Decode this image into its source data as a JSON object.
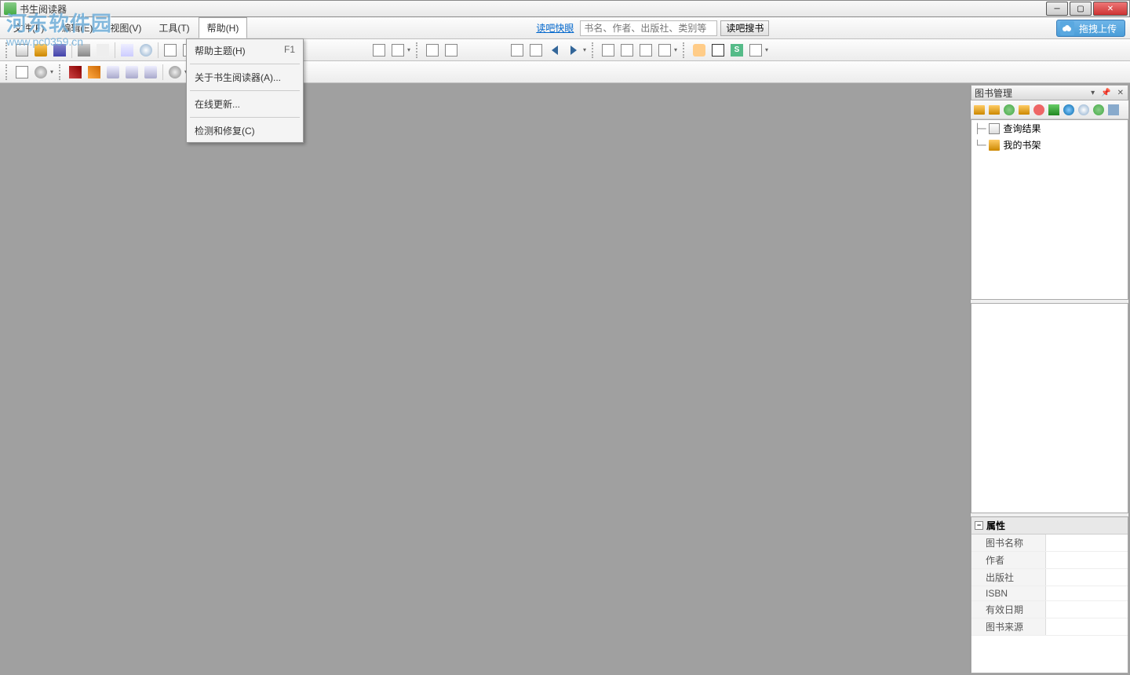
{
  "window": {
    "title": "书生阅读器"
  },
  "watermark": {
    "line1": "河东软件园",
    "line2": "www.pc0359.cn"
  },
  "menubar": {
    "items": [
      {
        "label": "文件(F)"
      },
      {
        "label": "编辑(E)"
      },
      {
        "label": "视图(V)"
      },
      {
        "label": "工具(T)"
      },
      {
        "label": "帮助(H)",
        "active": true
      }
    ],
    "link1": "读吧快眼",
    "search_placeholder": "书名、作者、出版社、类别等",
    "search_btn": "读吧搜书",
    "upload_btn": "拖拽上传"
  },
  "help_menu": {
    "items": [
      {
        "label": "帮助主题(H)",
        "shortcut": "F1"
      },
      {
        "label": "关于书生阅读器(A)..."
      },
      {
        "label": "在线更新..."
      },
      {
        "label": "检测和修复(C)"
      }
    ]
  },
  "sidebar": {
    "panel_title": "图书管理",
    "tree": {
      "node1": "查询结果",
      "node2": "我的书架"
    },
    "props": {
      "header": "属性",
      "rows": [
        {
          "label": "图书名称"
        },
        {
          "label": "作者"
        },
        {
          "label": "出版社"
        },
        {
          "label": "ISBN"
        },
        {
          "label": "有效日期"
        },
        {
          "label": "图书来源"
        }
      ]
    }
  }
}
